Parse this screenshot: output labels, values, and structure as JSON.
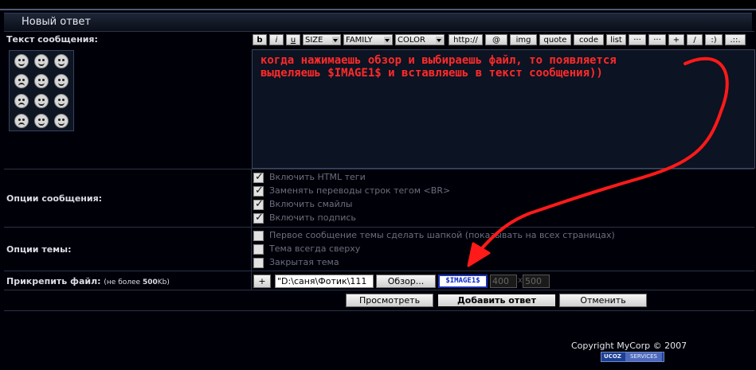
{
  "header": {
    "title": "Новый ответ"
  },
  "message_row": {
    "label": "Текст сообщения:"
  },
  "smiles": [
    "smile",
    "wink",
    "cool",
    "sad",
    "happy",
    "smile",
    "sad",
    "smile",
    "surprised",
    "angry",
    "smile",
    "wink"
  ],
  "toolbar": {
    "buttons": [
      "b",
      "i",
      "u",
      "http://",
      "@",
      "img",
      "quote",
      "code",
      "list",
      "···",
      "···",
      "+",
      "/",
      ":)",
      ".::."
    ],
    "size_label": "SIZE",
    "family_label": "FAMILY",
    "color_label": "COLOR"
  },
  "message": {
    "text_line1": "когда нажимаешь обзор и выбираешь файл, то появляется",
    "text_line2": "выделяешь $IMAGE1$ и вставляешь в текст сообщения))"
  },
  "message_options": {
    "label": "Опции сообщения:",
    "items": [
      {
        "label": "Включить HTML теги",
        "checked": true
      },
      {
        "label": "Заменять переводы строк тегом <BR>",
        "checked": true
      },
      {
        "label": "Включить смайлы",
        "checked": true
      },
      {
        "label": "Включить подпись",
        "checked": true
      }
    ]
  },
  "topic_options": {
    "label": "Опции темы:",
    "items": [
      {
        "label": "Первое сообщение темы сделать шапкой (показывать на всех страницах)",
        "checked": false
      },
      {
        "label": "Тема всегда сверху",
        "checked": false
      },
      {
        "label": "Закрытая тема",
        "checked": false
      }
    ]
  },
  "attach": {
    "label": "Прикрепить файл:",
    "limit_note_prefix": "(не более ",
    "limit_value": "500",
    "limit_unit": "Kb)",
    "add_label": "+",
    "file_value": "\"D:\\саня\\Фотик\\111",
    "browse_label": "Обзор...",
    "image_tag": "$IMAGE1$",
    "width_value": "400",
    "x_sep": "x",
    "height_value": "500"
  },
  "actions": {
    "preview_label": "Просмотреть",
    "submit_label": "Добавить ответ",
    "cancel_label": "Отменить"
  },
  "footer": {
    "copyright": "Copyright MyCorp © 2007",
    "badge_left": "UCOZ",
    "badge_right": "SERVICES"
  },
  "colors": {
    "annotation": "#ff1a1a",
    "message_text": "#ff2a2a",
    "background": "#000008"
  }
}
